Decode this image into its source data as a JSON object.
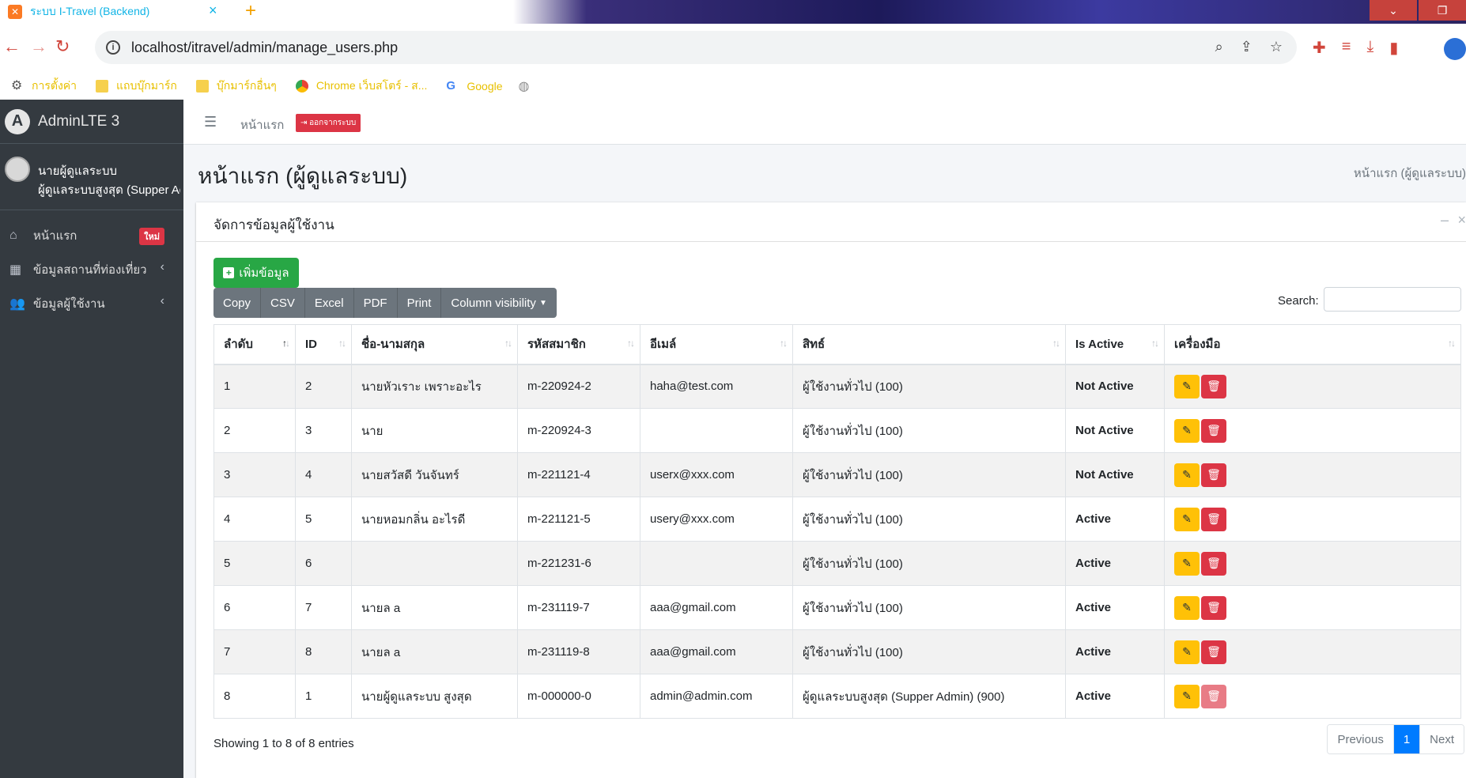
{
  "browser": {
    "tab_title": "ระบบ I-Travel (Backend)",
    "tab_close": "×",
    "new_tab": "+",
    "url": "localhost/itravel/admin/manage_users.php",
    "bookmarks": [
      {
        "label": "การตั้งค่า",
        "icon": "gear-icon"
      },
      {
        "label": "แถบบุ๊กมาร์ก",
        "icon": "folder-icon"
      },
      {
        "label": "บุ๊กมาร์กอื่นๆ",
        "icon": "folder-icon"
      },
      {
        "label": "Chrome เว็บสโตร์ - ส...",
        "icon": "chrome-webstore-icon"
      },
      {
        "label": "Google",
        "icon": "google-icon"
      }
    ]
  },
  "sidebar": {
    "brand": "AdminLTE 3",
    "user_name": "นายผู้ดูแลระบบ",
    "user_role": "ผู้ดูแลระบบสูงสุด (Supper Admin)",
    "items": [
      {
        "label": "หน้าแรก",
        "icon": "home-icon",
        "badge": "ใหม่"
      },
      {
        "label": "ข้อมูลสถานที่ท่องเที่ยว",
        "icon": "grid-icon"
      },
      {
        "label": "ข้อมูลผู้ใช้งาน",
        "icon": "users-icon"
      }
    ]
  },
  "topnav": {
    "home": "หน้าแรก",
    "logout": "ออกจากระบบ"
  },
  "header": {
    "title": "หน้าแรก (ผู้ดูแลระบบ)",
    "breadcrumb": "หน้าแรก (ผู้ดูแลระบบ)"
  },
  "card": {
    "title": "จัดการข้อมูลผู้ใช้งาน",
    "add_button": "เพิ่มข้อมูล",
    "export_buttons": [
      "Copy",
      "CSV",
      "Excel",
      "PDF",
      "Print",
      "Column visibility"
    ],
    "search_label": "Search:",
    "search_value": ""
  },
  "table": {
    "columns": [
      "ลำดับ",
      "ID",
      "ชื่อ-นามสกุล",
      "รหัสสมาชิก",
      "อีเมล์",
      "สิทธ์",
      "Is Active",
      "เครื่องมือ"
    ],
    "rows": [
      [
        "1",
        "2",
        "นายหัวเราะ เพราะอะไร",
        "m-220924-2",
        "haha@test.com",
        "ผู้ใช้งานทั่วไป (100)",
        "Not Active"
      ],
      [
        "2",
        "3",
        "นาย",
        "m-220924-3",
        "",
        "ผู้ใช้งานทั่วไป (100)",
        "Not Active"
      ],
      [
        "3",
        "4",
        "นายสวัสดี วันจันทร์",
        "m-221121-4",
        "userx@xxx.com",
        "ผู้ใช้งานทั่วไป (100)",
        "Not Active"
      ],
      [
        "4",
        "5",
        "นายหอมกลิ่น อะไรดี",
        "m-221121-5",
        "usery@xxx.com",
        "ผู้ใช้งานทั่วไป (100)",
        "Active"
      ],
      [
        "5",
        "6",
        "",
        "m-221231-6",
        "",
        "ผู้ใช้งานทั่วไป (100)",
        "Active"
      ],
      [
        "6",
        "7",
        "นายล a",
        "m-231119-7",
        "aaa@gmail.com",
        "ผู้ใช้งานทั่วไป (100)",
        "Active"
      ],
      [
        "7",
        "8",
        "นายล a",
        "m-231119-8",
        "aaa@gmail.com",
        "ผู้ใช้งานทั่วไป (100)",
        "Active"
      ],
      [
        "8",
        "1",
        "นายผู้ดูแลระบบ สูงสุด",
        "m-000000-0",
        "admin@admin.com",
        "ผู้ดูแลระบบสูงสุด (Supper Admin) (900)",
        "Active"
      ]
    ]
  },
  "footer": {
    "info": "Showing 1 to 8 of 8 entries",
    "previous": "Previous",
    "page": "1",
    "next": "Next"
  },
  "colors": {
    "sidebar_bg": "#343a40",
    "add_button": "#28a745",
    "edit_button": "#ffc107",
    "delete_button": "#dc3545",
    "pager_active": "#007bff"
  }
}
